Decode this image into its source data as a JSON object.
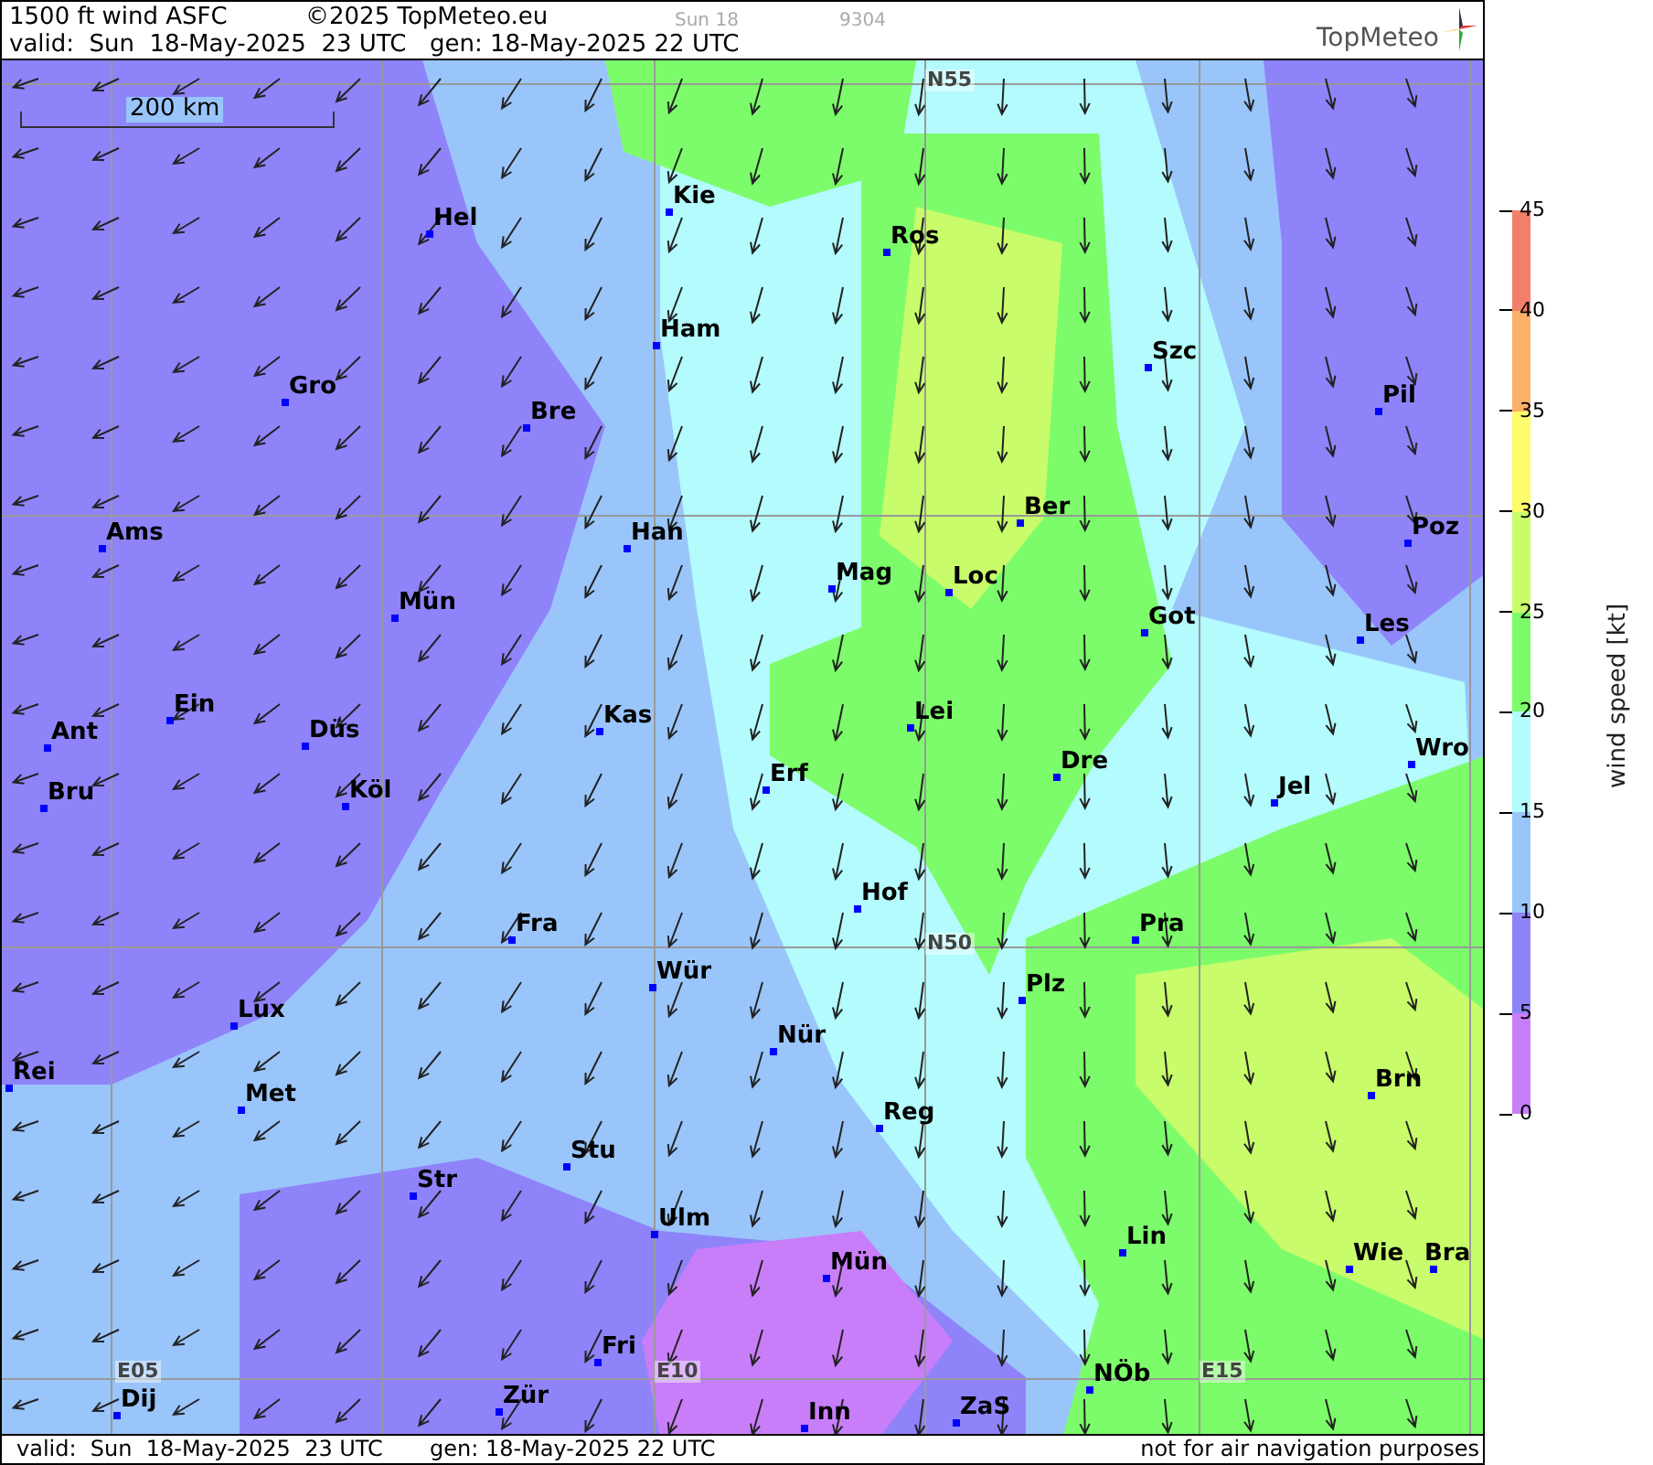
{
  "header": {
    "title": "1500 ft wind ASFC",
    "copyright": "©2025 TopMeteo.eu",
    "day": "Sun 18",
    "code": "9304",
    "valid": "valid:  Sun  18-May-2025  23 UTC",
    "generated": "gen: 18-May-2025 22 UTC",
    "logo": "TopMeteo"
  },
  "map": {
    "scale": "200 km",
    "grid_labels": [
      "N55",
      "N50",
      "E05",
      "E10",
      "E15"
    ],
    "cities": [
      {
        "name": "Hel"
      },
      {
        "name": "Kie"
      },
      {
        "name": "Ros"
      },
      {
        "name": "Ham"
      },
      {
        "name": "Szc"
      },
      {
        "name": "Gro"
      },
      {
        "name": "Bre"
      },
      {
        "name": "Pil"
      },
      {
        "name": "Ber"
      },
      {
        "name": "Ams"
      },
      {
        "name": "Han"
      },
      {
        "name": "Poz"
      },
      {
        "name": "Mag"
      },
      {
        "name": "Loc"
      },
      {
        "name": "Mün"
      },
      {
        "name": "Got"
      },
      {
        "name": "Les"
      },
      {
        "name": "Ein"
      },
      {
        "name": "Lei"
      },
      {
        "name": "Ant"
      },
      {
        "name": "Kas"
      },
      {
        "name": "Düs"
      },
      {
        "name": "Wro"
      },
      {
        "name": "Dre"
      },
      {
        "name": "Erf"
      },
      {
        "name": "Bru"
      },
      {
        "name": "Köl"
      },
      {
        "name": "Jel"
      },
      {
        "name": "Hof"
      },
      {
        "name": "Fra"
      },
      {
        "name": "Pra"
      },
      {
        "name": "Wür"
      },
      {
        "name": "Plz"
      },
      {
        "name": "Lux"
      },
      {
        "name": "Nür"
      },
      {
        "name": "Rei"
      },
      {
        "name": "Met"
      },
      {
        "name": "Brn"
      },
      {
        "name": "Reg"
      },
      {
        "name": "Stu"
      },
      {
        "name": "Str"
      },
      {
        "name": "Ulm"
      },
      {
        "name": "Lin"
      },
      {
        "name": "Wie"
      },
      {
        "name": "Bra"
      },
      {
        "name": "Mün"
      },
      {
        "name": "Fri"
      },
      {
        "name": "NÖb"
      },
      {
        "name": "Dij"
      },
      {
        "name": "Zür"
      },
      {
        "name": "Inn"
      },
      {
        "name": "ZaS"
      }
    ]
  },
  "legend": {
    "title": "wind speed [kt]",
    "bands": [
      {
        "color": "#f37e6a"
      },
      {
        "color": "#fdb06a"
      },
      {
        "color": "#fdfc6a"
      },
      {
        "color": "#c8fc6a"
      },
      {
        "color": "#7cfc6a"
      },
      {
        "color": "#b3fbfc"
      },
      {
        "color": "#99c5fb"
      },
      {
        "color": "#8f83fa"
      },
      {
        "color": "#c97ef9"
      }
    ],
    "ticks": [
      "45",
      "40",
      "35",
      "30",
      "25",
      "20",
      "15",
      "10",
      "5",
      "0"
    ]
  },
  "footer": {
    "valid": "valid:  Sun  18-May-2025  23 UTC",
    "generated": "gen: 18-May-2025 22 UTC",
    "note": "not for air navigation purposes"
  }
}
